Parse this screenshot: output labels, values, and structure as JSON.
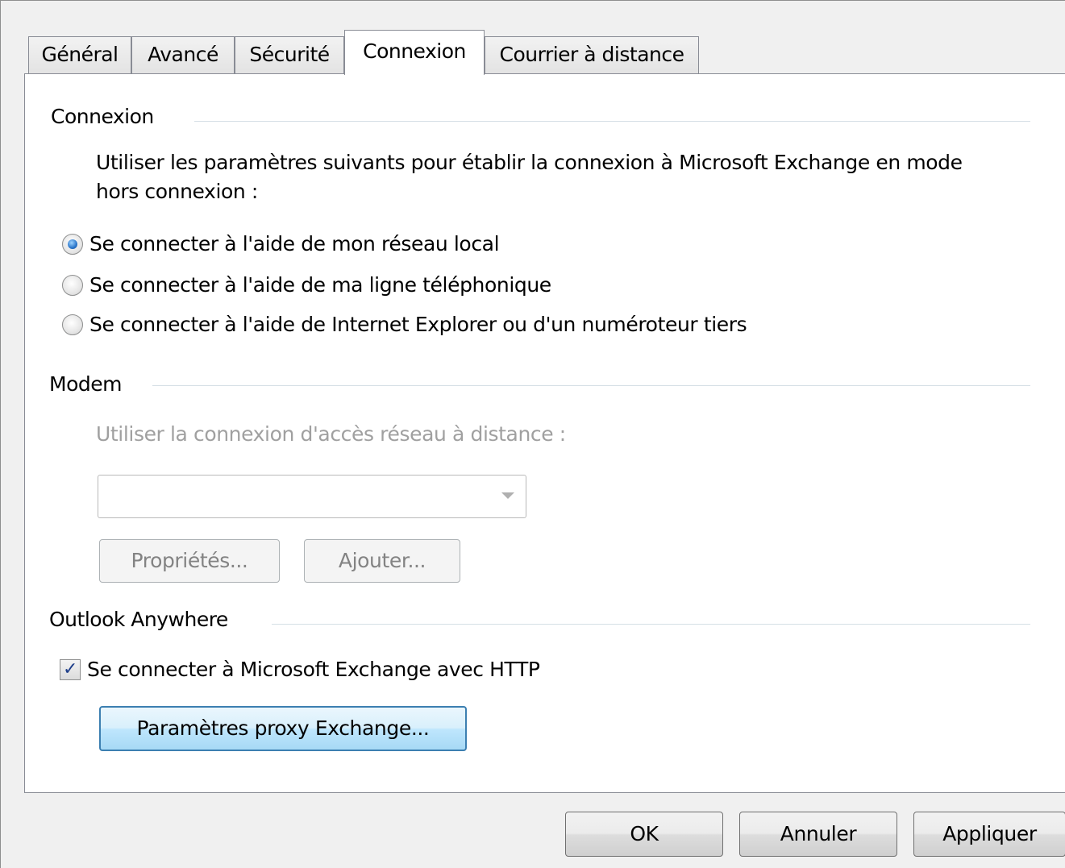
{
  "tabs": [
    {
      "label": "Général",
      "active": false
    },
    {
      "label": "Avancé",
      "active": false
    },
    {
      "label": "Sécurité",
      "active": false
    },
    {
      "label": "Connexion",
      "active": true
    },
    {
      "label": "Courrier à distance",
      "active": false
    }
  ],
  "connexion": {
    "title": "Connexion",
    "description_line1": "Utiliser les paramètres suivants pour établir la connexion à Microsoft Exchange en mode",
    "description_line2": "hors connexion :",
    "options": [
      {
        "label": "Se connecter à l'aide de mon réseau local",
        "selected": true
      },
      {
        "label": "Se connecter à l'aide de ma ligne téléphonique",
        "selected": false
      },
      {
        "label": "Se connecter à l'aide de Internet Explorer ou d'un numéroteur tiers",
        "selected": false
      }
    ]
  },
  "modem": {
    "title": "Modem",
    "dialup_label": "Utiliser la connexion d'accès réseau à distance :",
    "dialup_value": "",
    "properties_button": "Propriétés...",
    "add_button": "Ajouter..."
  },
  "outlook_anywhere": {
    "title": "Outlook Anywhere",
    "http_checkbox_label": "Se connecter à Microsoft Exchange avec HTTP",
    "http_checked": true,
    "proxy_button": "Paramètres proxy Exchange..."
  },
  "footer": {
    "ok": "OK",
    "cancel": "Annuler",
    "apply": "Appliquer"
  },
  "icons": {
    "checkmark": "checkmark-icon",
    "dropdown": "chevron-down-icon"
  },
  "colors": {
    "panel_bg": "#ffffff",
    "window_bg": "#f0f0f0",
    "focus_button": "#bee6fd",
    "disabled_text": "#a0a0a0"
  }
}
